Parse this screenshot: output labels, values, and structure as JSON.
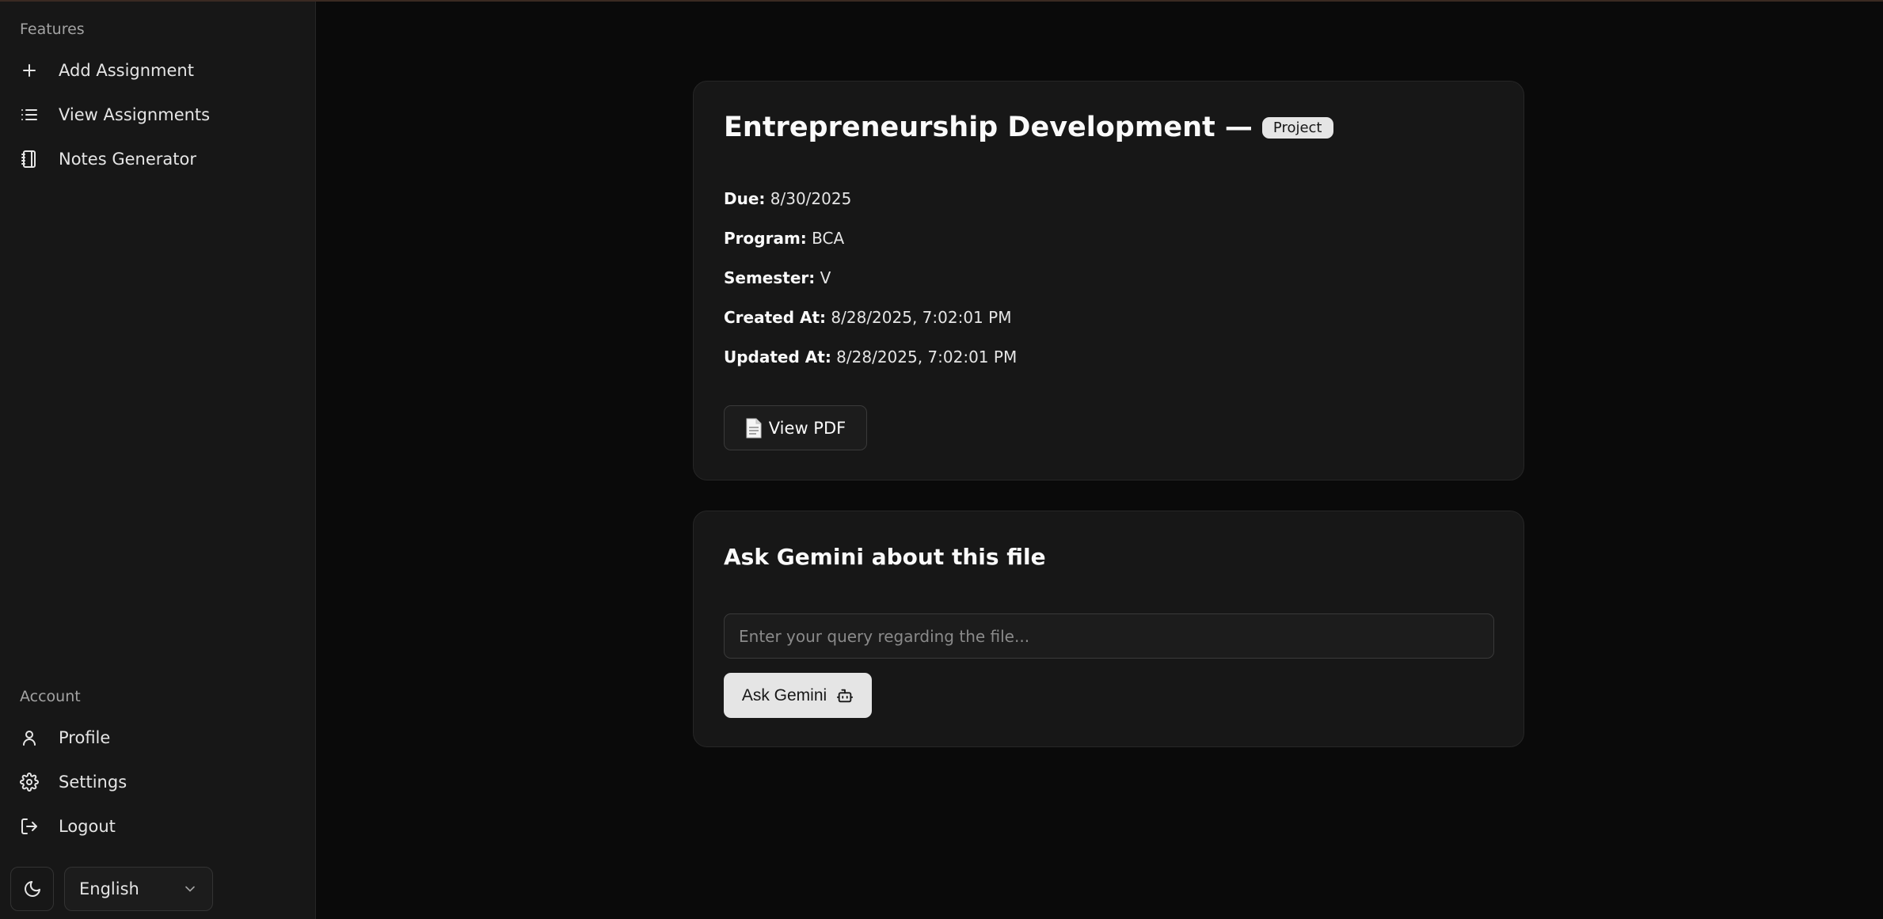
{
  "sidebar": {
    "features_label": "Features",
    "features": [
      {
        "label": "Add Assignment",
        "icon": "plus-icon"
      },
      {
        "label": "View Assignments",
        "icon": "list-icon"
      },
      {
        "label": "Notes Generator",
        "icon": "notebook-icon"
      }
    ],
    "account_label": "Account",
    "account": [
      {
        "label": "Profile",
        "icon": "user-icon"
      },
      {
        "label": "Settings",
        "icon": "gear-icon"
      },
      {
        "label": "Logout",
        "icon": "logout-icon"
      }
    ],
    "language": "English"
  },
  "assignment": {
    "title": "Entrepreneurship Development —",
    "badge": "Project",
    "fields": [
      {
        "label": "Due:",
        "value": "8/30/2025"
      },
      {
        "label": "Program:",
        "value": "BCA"
      },
      {
        "label": "Semester:",
        "value": "V"
      },
      {
        "label": "Created At:",
        "value": "8/28/2025, 7:02:01 PM"
      },
      {
        "label": "Updated At:",
        "value": "8/28/2025, 7:02:01 PM"
      }
    ],
    "view_pdf_label": "View PDF"
  },
  "gemini": {
    "title": "Ask Gemini about this file",
    "placeholder": "Enter your query regarding the file...",
    "ask_label": "Ask Gemini"
  },
  "colors": {
    "background": "#0a0a0a",
    "sidebar": "#171717",
    "card": "#171717",
    "badge": "#e5e5e5"
  }
}
